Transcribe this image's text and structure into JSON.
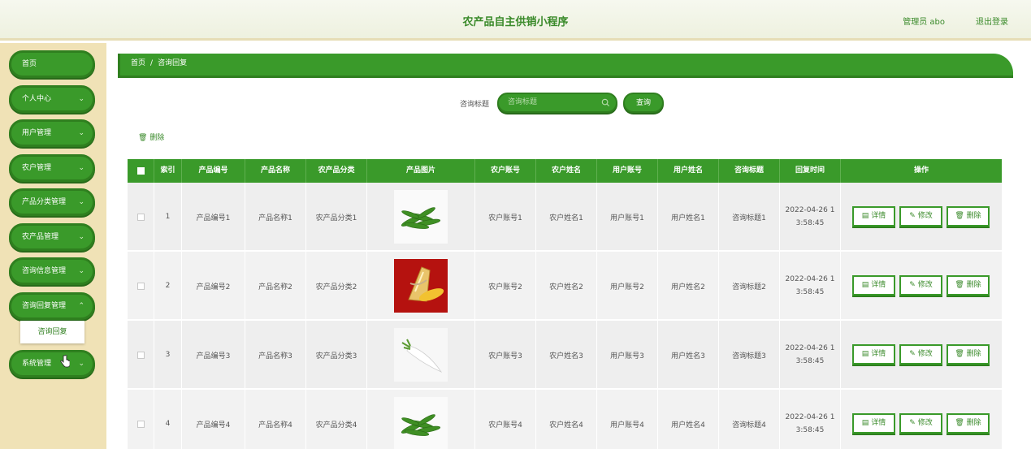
{
  "app": {
    "title": "农产品自主供销小程序",
    "admin_label": "管理员 abo",
    "logout": "退出登录"
  },
  "sidebar": {
    "items": [
      {
        "label": "首页",
        "has_chevron": false
      },
      {
        "label": "个人中心",
        "has_chevron": true
      },
      {
        "label": "用户管理",
        "has_chevron": true
      },
      {
        "label": "农户管理",
        "has_chevron": true
      },
      {
        "label": "产品分类管理",
        "has_chevron": true
      },
      {
        "label": "农产品管理",
        "has_chevron": true
      },
      {
        "label": "咨询信息管理",
        "has_chevron": true
      },
      {
        "label": "咨询回复管理",
        "has_chevron": true
      },
      {
        "label": "系统管理",
        "has_chevron": true
      }
    ],
    "submenu_item": "咨询回复"
  },
  "breadcrumb": {
    "home": "首页",
    "sep": "/",
    "current": "咨询回复"
  },
  "search": {
    "label": "咨询标题",
    "placeholder": "咨询标题",
    "button": "查询"
  },
  "toolbar": {
    "delete": "删除"
  },
  "colors": {
    "primary": "#3a9a2a",
    "primary_dark": "#2f7f1f",
    "sidebar_bg": "#f0e2b6"
  },
  "table": {
    "headers": [
      "",
      "索引",
      "产品编号",
      "产品名称",
      "农产品分类",
      "产品图片",
      "农户账号",
      "农户姓名",
      "用户账号",
      "用户姓名",
      "咨询标题",
      "回复时间",
      "操作"
    ],
    "actions": {
      "detail": "详情",
      "edit": "修改",
      "delete": "删除"
    },
    "rows": [
      {
        "index": "1",
        "product_no": "产品编号1",
        "product_name": "产品名称1",
        "category": "农产品分类1",
        "image": "green-beans",
        "farmer_account": "农户账号1",
        "farmer_name": "农户姓名1",
        "user_account": "用户账号1",
        "user_name": "用户姓名1",
        "title": "咨询标题1",
        "time_line1": "2022-04-26 1",
        "time_line2": "3:58:45"
      },
      {
        "index": "2",
        "product_no": "产品编号2",
        "product_name": "产品名称2",
        "category": "农产品分类2",
        "image": "bamboo-shoot",
        "farmer_account": "农户账号2",
        "farmer_name": "农户姓名2",
        "user_account": "用户账号2",
        "user_name": "用户姓名2",
        "title": "咨询标题2",
        "time_line1": "2022-04-26 1",
        "time_line2": "3:58:45"
      },
      {
        "index": "3",
        "product_no": "产品编号3",
        "product_name": "产品名称3",
        "category": "农产品分类3",
        "image": "white-radish",
        "farmer_account": "农户账号3",
        "farmer_name": "农户姓名3",
        "user_account": "用户账号3",
        "user_name": "用户姓名3",
        "title": "咨询标题3",
        "time_line1": "2022-04-26 1",
        "time_line2": "3:58:45"
      },
      {
        "index": "4",
        "product_no": "产品编号4",
        "product_name": "产品名称4",
        "category": "农产品分类4",
        "image": "green-beans",
        "farmer_account": "农户账号4",
        "farmer_name": "农户姓名4",
        "user_account": "用户账号4",
        "user_name": "用户姓名4",
        "title": "咨询标题4",
        "time_line1": "2022-04-26 1",
        "time_line2": "3:58:45"
      }
    ]
  }
}
